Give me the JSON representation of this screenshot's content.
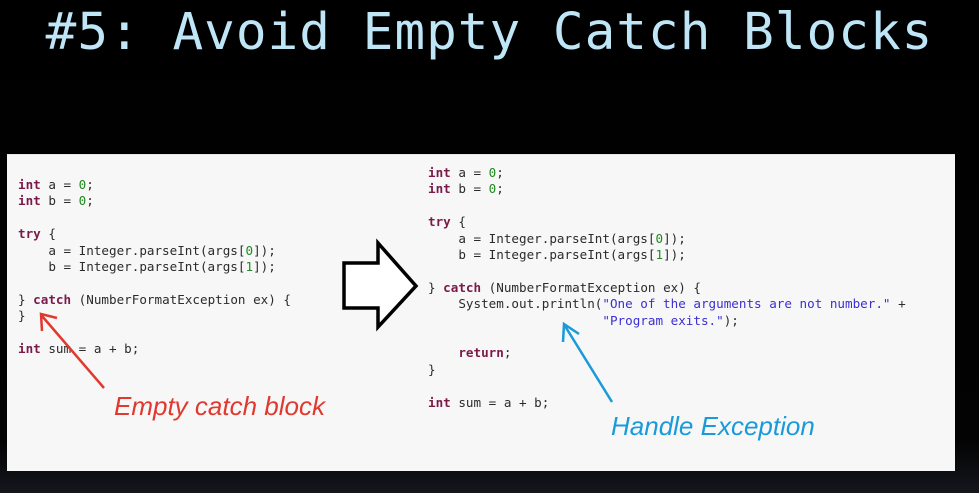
{
  "slide": {
    "title": "#5: Avoid Empty Catch Blocks"
  },
  "left_code": {
    "l1_kw": "int",
    "l1_rest": " a = ",
    "l1_num": "0",
    "l1_end": ";",
    "l2_kw": "int",
    "l2_rest": " b = ",
    "l2_num": "0",
    "l2_end": ";",
    "l4_kw": "try",
    "l4_rest": " {",
    "l5": "    a = Integer.parseInt(args[",
    "l5_num": "0",
    "l5_end": "]);",
    "l6": "    b = Integer.parseInt(args[",
    "l6_num": "1",
    "l6_end": "]);",
    "l8_a": "} ",
    "l8_kw": "catch",
    "l8_b": " (NumberFormatException ex) {",
    "l9": "}",
    "l11_kw": "int",
    "l11_rest": " sum = a + b;"
  },
  "right_code": {
    "l1_kw": "int",
    "l1_rest": " a = ",
    "l1_num": "0",
    "l1_end": ";",
    "l2_kw": "int",
    "l2_rest": " b = ",
    "l2_num": "0",
    "l2_end": ";",
    "l4_kw": "try",
    "l4_rest": " {",
    "l5": "    a = Integer.parseInt(args[",
    "l5_num": "0",
    "l5_end": "]);",
    "l6": "    b = Integer.parseInt(args[",
    "l6_num": "1",
    "l6_end": "]);",
    "l8_a": "} ",
    "l8_kw": "catch",
    "l8_b": " (NumberFormatException ex) {",
    "l9_a": "    System.out.println(",
    "l9_str": "\"One of the arguments are not number.\"",
    "l9_b": " +",
    "l10_pad": "                       ",
    "l10_str": "\"Program exits.\"",
    "l10_b": ");",
    "l12_pad": "    ",
    "l12_kw": "return",
    "l12_b": ";",
    "l13": "}",
    "l15_kw": "int",
    "l15_rest": " sum = a + b;"
  },
  "annotations": {
    "empty_catch": "Empty catch block",
    "handle_exception": "Handle Exception"
  },
  "colors": {
    "title": "#bfe6f7",
    "keyword": "#7a1a4a",
    "number": "#1f8a1f",
    "string": "#3b2fd1",
    "annotation_red": "#e0392f",
    "annotation_blue": "#1a9ad9"
  },
  "icons": {
    "transition": "right-arrow-outline-icon",
    "pointer_red": "red-pointer-arrow-icon",
    "pointer_blue": "blue-pointer-arrow-icon"
  }
}
